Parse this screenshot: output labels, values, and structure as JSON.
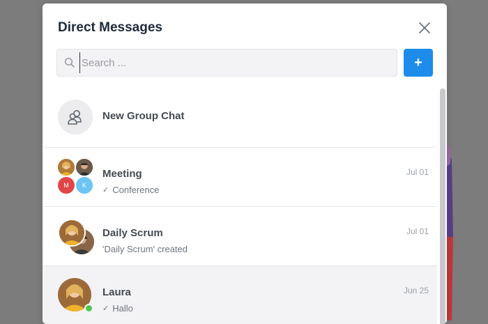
{
  "modal": {
    "title": "Direct Messages",
    "close_icon": "close-icon"
  },
  "search": {
    "placeholder": "Search ...",
    "value": "",
    "icon": "search-icon"
  },
  "add_button": {
    "label": "+"
  },
  "new_group": {
    "label": "New Group Chat",
    "icon": "group-icon"
  },
  "conversations": [
    {
      "name": "Meeting",
      "last_message": "Conference",
      "date": "Jul 01",
      "initials": [
        "M",
        "K"
      ]
    },
    {
      "name": "Daily Scrum",
      "last_message": "'Daily Scrum' created",
      "date": "Jul 01"
    },
    {
      "name": "Laura",
      "last_message": "Hallo",
      "date": "Jun 25",
      "online": true
    }
  ],
  "colors": {
    "accent": "#1d8ceb",
    "initial_m": "#e04646",
    "initial_k": "#6cc4f2",
    "online": "#4cc84c"
  }
}
